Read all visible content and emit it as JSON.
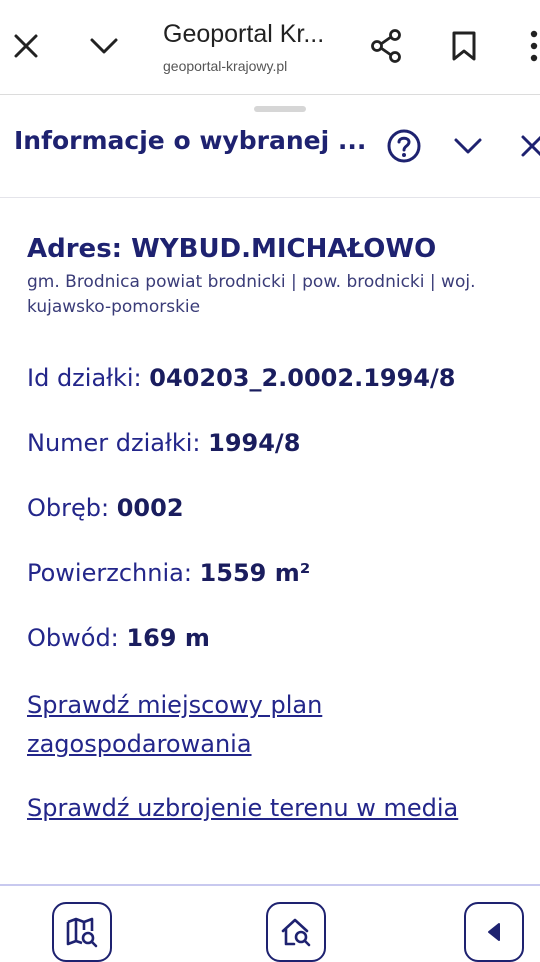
{
  "browser": {
    "title": "Geoportal Kr...",
    "url": "geoportal-krajowy.pl",
    "icons": [
      "close-icon",
      "chevron-down-icon",
      "share-icon",
      "bookmark-icon",
      "more-vert-icon"
    ]
  },
  "panel": {
    "title": "Informacje o wybranej ...",
    "icons": [
      "help-icon",
      "chevron-down-icon",
      "close-icon"
    ]
  },
  "address": {
    "label": "Adres: WYBUD.MICHAŁOWO",
    "sub": "gm. Brodnica powiat brodnicki | pow. brodnicki | woj. kujawsko-pomorskie"
  },
  "fields": {
    "id": {
      "label": "Id działki:",
      "value": "040203_2.0002.1994/8"
    },
    "number": {
      "label": "Numer działki:",
      "value": "1994/8"
    },
    "precinct": {
      "label": "Obręb:",
      "value": "0002"
    },
    "area": {
      "label": "Powierzchnia:",
      "value": "1559 m²"
    },
    "perimeter": {
      "label": "Obwód:",
      "value": "169 m"
    }
  },
  "links": {
    "plan": "Sprawdź miejscowy plan zagospodarowania",
    "utilities": "Sprawdź uzbrojenie terenu w media"
  },
  "bottom_nav": {
    "icons": [
      "map-search-icon",
      "home-search-icon",
      "back-arrow-icon"
    ]
  },
  "colors": {
    "primary": "#1e2270",
    "text": "#23268a",
    "border": "#c8c9ef"
  }
}
